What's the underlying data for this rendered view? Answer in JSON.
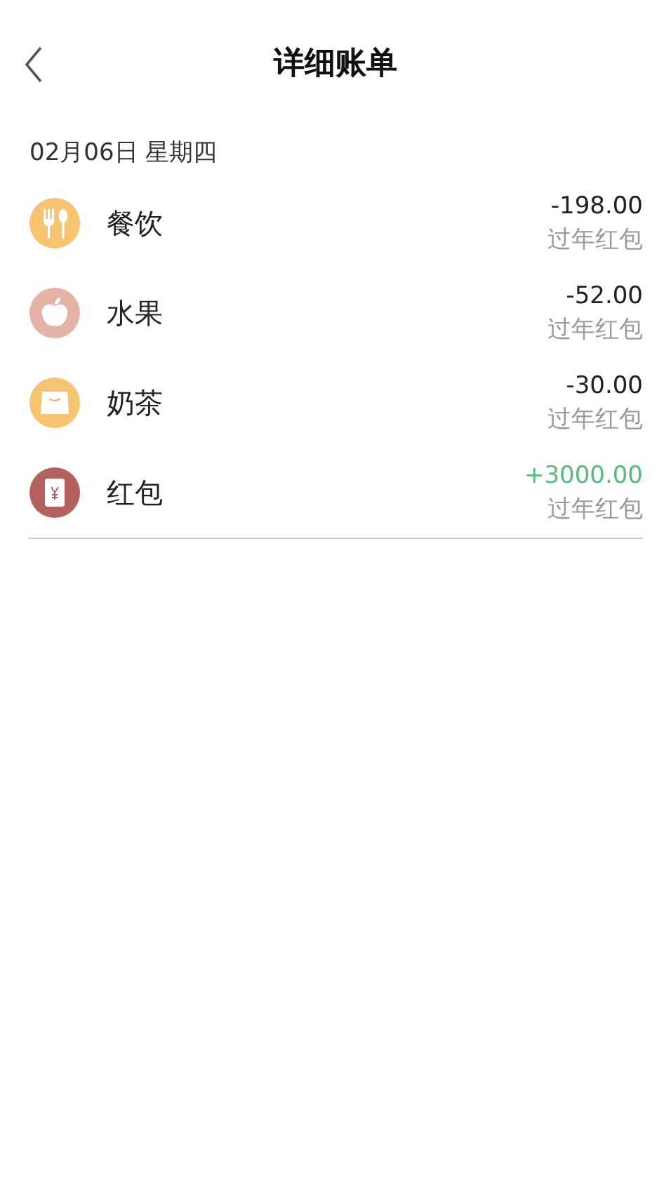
{
  "header": {
    "title": "详细账单"
  },
  "date": "02月06日 星期四",
  "entries": [
    {
      "kind": "dining",
      "color": "#f6c46e",
      "name": "餐饮",
      "amount": "-198.00",
      "income": false,
      "note": "过年红包"
    },
    {
      "kind": "fruit",
      "color": "#e5b3a6",
      "name": "水果",
      "amount": "-52.00",
      "income": false,
      "note": "过年红包"
    },
    {
      "kind": "tea",
      "color": "#f6c46e",
      "name": "奶茶",
      "amount": "-30.00",
      "income": false,
      "note": "过年红包"
    },
    {
      "kind": "envelope",
      "color": "#b5625e",
      "name": "红包",
      "amount": "+3000.00",
      "income": true,
      "note": "过年红包"
    }
  ]
}
